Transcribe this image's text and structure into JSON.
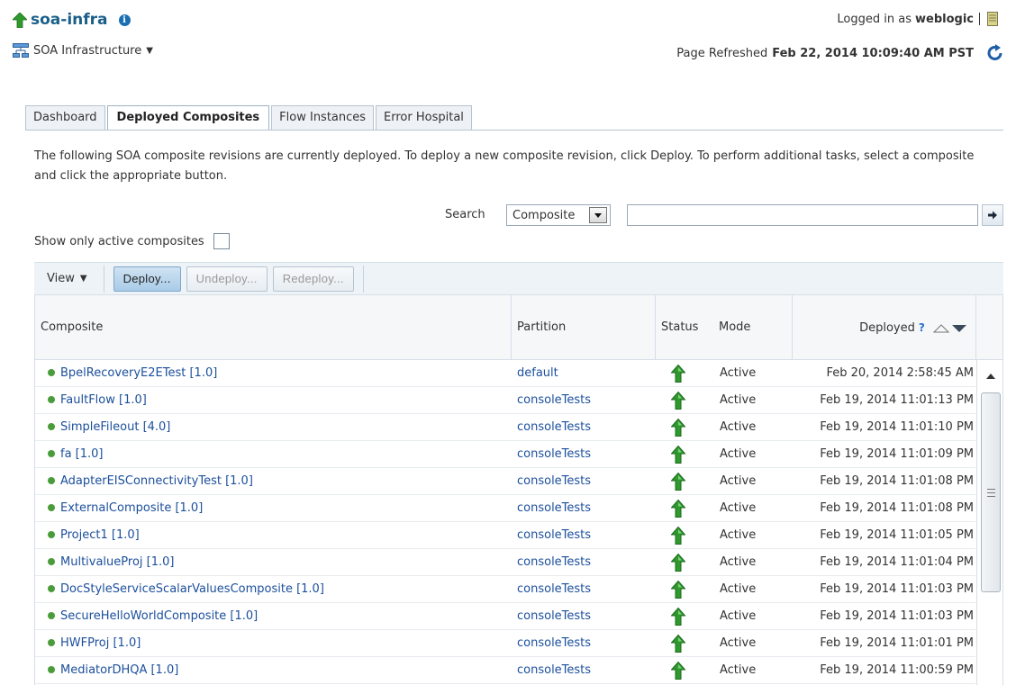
{
  "header": {
    "title": "soa-infra",
    "target_menu_label": "SOA Infrastructure",
    "logged_in_prefix": "Logged in as",
    "user": "weblogic",
    "refreshed_prefix": "Page Refreshed",
    "refreshed_time": "Feb 22, 2014 10:09:40 AM PST"
  },
  "tabs": [
    {
      "label": "Dashboard",
      "active": false
    },
    {
      "label": "Deployed Composites",
      "active": true
    },
    {
      "label": "Flow Instances",
      "active": false
    },
    {
      "label": "Error Hospital",
      "active": false
    }
  ],
  "description": "The following SOA composite revisions are currently deployed. To deploy a new composite revision, click Deploy. To perform additional tasks, select a composite and click the appropriate button.",
  "search": {
    "label": "Search",
    "selected": "Composite",
    "value": ""
  },
  "filter": {
    "label": "Show only active composites",
    "checked": false
  },
  "toolbar": {
    "view_label": "View",
    "deploy_label": "Deploy...",
    "undeploy_label": "Undeploy...",
    "redeploy_label": "Redeploy..."
  },
  "table": {
    "columns": {
      "composite": "Composite",
      "partition": "Partition",
      "status": "Status",
      "mode": "Mode",
      "deployed": "Deployed"
    },
    "rows": [
      {
        "composite": "BpelRecoveryE2ETest [1.0]",
        "partition": "default",
        "mode": "Active",
        "deployed": "Feb 20, 2014 2:58:45 AM"
      },
      {
        "composite": "FaultFlow [1.0]",
        "partition": "consoleTests",
        "mode": "Active",
        "deployed": "Feb 19, 2014 11:01:13 PM"
      },
      {
        "composite": "SimpleFileout [4.0]",
        "partition": "consoleTests",
        "mode": "Active",
        "deployed": "Feb 19, 2014 11:01:10 PM"
      },
      {
        "composite": "fa [1.0]",
        "partition": "consoleTests",
        "mode": "Active",
        "deployed": "Feb 19, 2014 11:01:09 PM"
      },
      {
        "composite": "AdapterEISConnectivityTest [1.0]",
        "partition": "consoleTests",
        "mode": "Active",
        "deployed": "Feb 19, 2014 11:01:08 PM"
      },
      {
        "composite": "ExternalComposite [1.0]",
        "partition": "consoleTests",
        "mode": "Active",
        "deployed": "Feb 19, 2014 11:01:08 PM"
      },
      {
        "composite": "Project1 [1.0]",
        "partition": "consoleTests",
        "mode": "Active",
        "deployed": "Feb 19, 2014 11:01:05 PM"
      },
      {
        "composite": "MultivalueProj [1.0]",
        "partition": "consoleTests",
        "mode": "Active",
        "deployed": "Feb 19, 2014 11:01:04 PM"
      },
      {
        "composite": "DocStyleServiceScalarValuesComposite [1.0]",
        "partition": "consoleTests",
        "mode": "Active",
        "deployed": "Feb 19, 2014 11:01:03 PM"
      },
      {
        "composite": "SecureHelloWorldComposite [1.0]",
        "partition": "consoleTests",
        "mode": "Active",
        "deployed": "Feb 19, 2014 11:01:03 PM"
      },
      {
        "composite": "HWFProj [1.0]",
        "partition": "consoleTests",
        "mode": "Active",
        "deployed": "Feb 19, 2014 11:01:01 PM"
      },
      {
        "composite": "MediatorDHQA [1.0]",
        "partition": "consoleTests",
        "mode": "Active",
        "deployed": "Feb 19, 2014 11:00:59 PM"
      }
    ]
  },
  "icons": {
    "status_up": "green-up-arrow-icon",
    "refresh": "refresh-icon",
    "info": "info-icon",
    "topology": "topology-icon"
  },
  "colors": {
    "status_green": "#2e8b2e",
    "link_blue": "#1b4f9c",
    "title_blue": "#1a5f8a"
  }
}
